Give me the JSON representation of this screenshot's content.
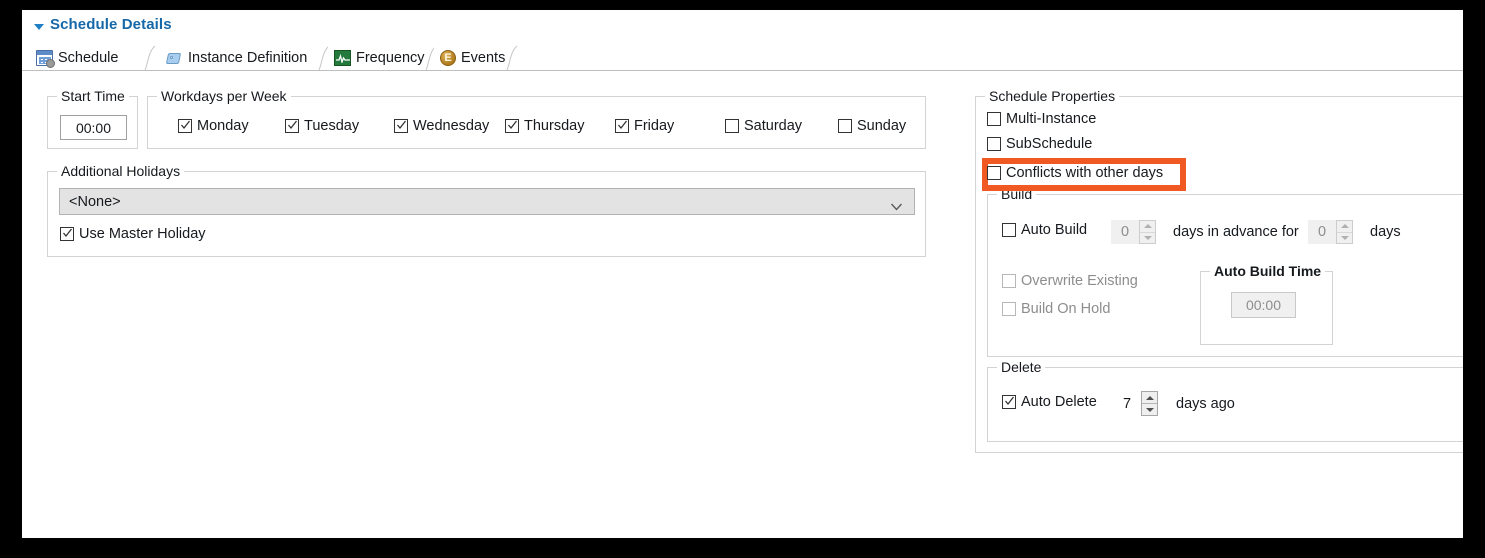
{
  "window": {
    "section_title": "Schedule Details",
    "collapse_icon": "triangle-down-icon",
    "accent_color": "#1668a8",
    "highlight_color": "#f05a22"
  },
  "tabs": [
    {
      "label": "Schedule",
      "icon": "calendar-settings-icon",
      "active": true
    },
    {
      "label": "Instance Definition",
      "icon": "tag-icon",
      "active": false
    },
    {
      "label": "Frequency",
      "icon": "waveform-icon",
      "active": false
    },
    {
      "label": "Events",
      "icon": "event-circle-e-icon",
      "active": false
    }
  ],
  "start_time": {
    "group_label": "Start Time",
    "value": "00:00"
  },
  "workdays": {
    "group_label": "Workdays per Week",
    "days": [
      {
        "label": "Monday",
        "checked": true
      },
      {
        "label": "Tuesday",
        "checked": true
      },
      {
        "label": "Wednesday",
        "checked": true
      },
      {
        "label": "Thursday",
        "checked": true
      },
      {
        "label": "Friday",
        "checked": true
      },
      {
        "label": "Saturday",
        "checked": false
      },
      {
        "label": "Sunday",
        "checked": false
      }
    ]
  },
  "additional_holidays": {
    "group_label": "Additional Holidays",
    "dropdown_value": "<None>",
    "dropdown_icon": "chevron-down-icon",
    "use_master_holiday": {
      "label": "Use Master Holiday",
      "checked": true
    }
  },
  "schedule_properties": {
    "group_label": "Schedule Properties",
    "options": [
      {
        "label": "Multi-Instance",
        "checked": false,
        "highlighted": false
      },
      {
        "label": "SubSchedule",
        "checked": false,
        "highlighted": false
      },
      {
        "label": "Conflicts with other days",
        "checked": false,
        "highlighted": true
      }
    ]
  },
  "build": {
    "group_label": "Build",
    "auto_build": {
      "label": "Auto Build",
      "checked": false
    },
    "days_in_advance_value": "0",
    "days_in_advance_label": "days in advance for",
    "for_days_value": "0",
    "for_days_label": "days",
    "overwrite_existing": {
      "label": "Overwrite Existing",
      "checked": false,
      "disabled": true
    },
    "build_on_hold": {
      "label": "Build On Hold",
      "checked": false,
      "disabled": true
    },
    "auto_build_time": {
      "group_label": "Auto Build Time",
      "value": "00:00",
      "disabled": true
    }
  },
  "delete": {
    "group_label": "Delete",
    "auto_delete": {
      "label": "Auto Delete",
      "checked": true
    },
    "value": "7",
    "suffix_label": "days ago"
  }
}
